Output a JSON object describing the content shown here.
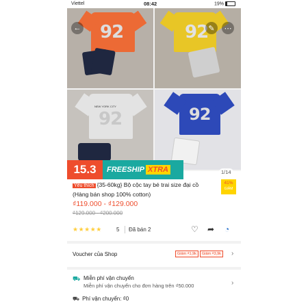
{
  "status_bar": {
    "carrier": "Viettel",
    "time": "08:42",
    "battery": "19%"
  },
  "gallery": {
    "counter": "1/14",
    "shirt_number": "92",
    "shirt_text": "NEW YORK CITY",
    "colors": {
      "orange": "#ec6a35",
      "yellow": "#e8c626",
      "gray": "#d9d9d9",
      "blue": "#2d49b8",
      "navy_shorts": "#1f2740",
      "gray_shorts": "#cfcfcf"
    }
  },
  "banner": {
    "sale_label": "15.3",
    "freeship_label": "FREESHIP",
    "xtra_label": "XTRA"
  },
  "product": {
    "favorite_badge": "Yêu thích",
    "title": "{35-60kg} Bộ cộc tay bé trai size đại cồ (Hàng bán shop 100% cotton)",
    "discount_percent": "41%",
    "discount_unit": "GIẢM",
    "price": "₫119.000 - ₫129.000",
    "old_price": "₫129.000 - ₫200.000",
    "rating": "5",
    "sold": "Đã bán 2"
  },
  "voucher": {
    "label": "Voucher của Shop",
    "chips": [
      "Giảm ₫1,9k",
      "Giảm ₫3,9k"
    ]
  },
  "shipping": {
    "free_title": "Miễn phí vận chuyển",
    "free_desc": "Miễn phí vận chuyển cho đơn hàng trên ₫50.000",
    "fee_label": "Phí vận chuyển: ₫0"
  },
  "theme": {
    "accent": "#ee4d2d",
    "teal": "#1aa9a0",
    "star": "#ffce3d"
  }
}
